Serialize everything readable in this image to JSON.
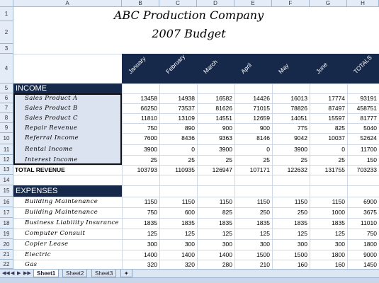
{
  "columns": [
    "A",
    "B",
    "C",
    "D",
    "E",
    "F",
    "G",
    "H"
  ],
  "rows": [
    "1",
    "2",
    "3",
    "4",
    "5",
    "6",
    "7",
    "8",
    "9",
    "10",
    "11",
    "12",
    "13",
    "14",
    "15",
    "16",
    "17",
    "18",
    "19",
    "20",
    "21",
    "22"
  ],
  "title1": "ABC Production Company",
  "title2": "2007 Budget",
  "months": [
    "January",
    "February",
    "March",
    "April",
    "May",
    "June",
    "TOTALS"
  ],
  "income_label": "INCOME",
  "expenses_label": "EXPENSES",
  "total_revenue_label": "TOTAL REVENUE",
  "income_rows": [
    {
      "label": "Sales Product A",
      "values": [
        "13458",
        "14938",
        "16582",
        "14426",
        "16013",
        "17774",
        "93191"
      ]
    },
    {
      "label": "Sales Product B",
      "values": [
        "66250",
        "73537",
        "81626",
        "71015",
        "78826",
        "87497",
        "458751"
      ]
    },
    {
      "label": "Sales Product C",
      "values": [
        "11810",
        "13109",
        "14551",
        "12659",
        "14051",
        "15597",
        "81777"
      ]
    },
    {
      "label": "Repair Revenue",
      "values": [
        "750",
        "890",
        "900",
        "900",
        "775",
        "825",
        "5040"
      ]
    },
    {
      "label": "Referral Income",
      "values": [
        "7600",
        "8436",
        "9363",
        "8146",
        "9042",
        "10037",
        "52624"
      ]
    },
    {
      "label": "Rental Income",
      "values": [
        "3900",
        "0",
        "3900",
        "0",
        "3900",
        "0",
        "11700"
      ]
    },
    {
      "label": "Interest Income",
      "values": [
        "25",
        "25",
        "25",
        "25",
        "25",
        "25",
        "150"
      ]
    }
  ],
  "total_revenue": [
    "103793",
    "110935",
    "126947",
    "107171",
    "122632",
    "131755",
    "703233"
  ],
  "expense_rows": [
    {
      "label": "Building Maintenance",
      "values": [
        "1150",
        "1150",
        "1150",
        "1150",
        "1150",
        "1150",
        "6900"
      ]
    },
    {
      "label": "Building Maintenance",
      "values": [
        "750",
        "600",
        "825",
        "250",
        "250",
        "1000",
        "3675"
      ]
    },
    {
      "label": "Business Liability Insurance",
      "values": [
        "1835",
        "1835",
        "1835",
        "1835",
        "1835",
        "1835",
        "11010"
      ]
    },
    {
      "label": "Computer Consult",
      "values": [
        "125",
        "125",
        "125",
        "125",
        "125",
        "125",
        "750"
      ]
    },
    {
      "label": "Copier Lease",
      "values": [
        "300",
        "300",
        "300",
        "300",
        "300",
        "300",
        "1800"
      ]
    },
    {
      "label": "Electric",
      "values": [
        "1400",
        "1400",
        "1400",
        "1500",
        "1500",
        "1800",
        "9000"
      ]
    },
    {
      "label": "Gas",
      "values": [
        "320",
        "320",
        "280",
        "210",
        "160",
        "160",
        "1450"
      ]
    }
  ],
  "sheet_tabs": [
    "Sheet1",
    "Sheet2",
    "Sheet3"
  ],
  "active_tab": "Sheet1",
  "colors": {
    "navy": "#17294a",
    "selection": "#dbe3f1",
    "header": "#e4ecf7"
  }
}
